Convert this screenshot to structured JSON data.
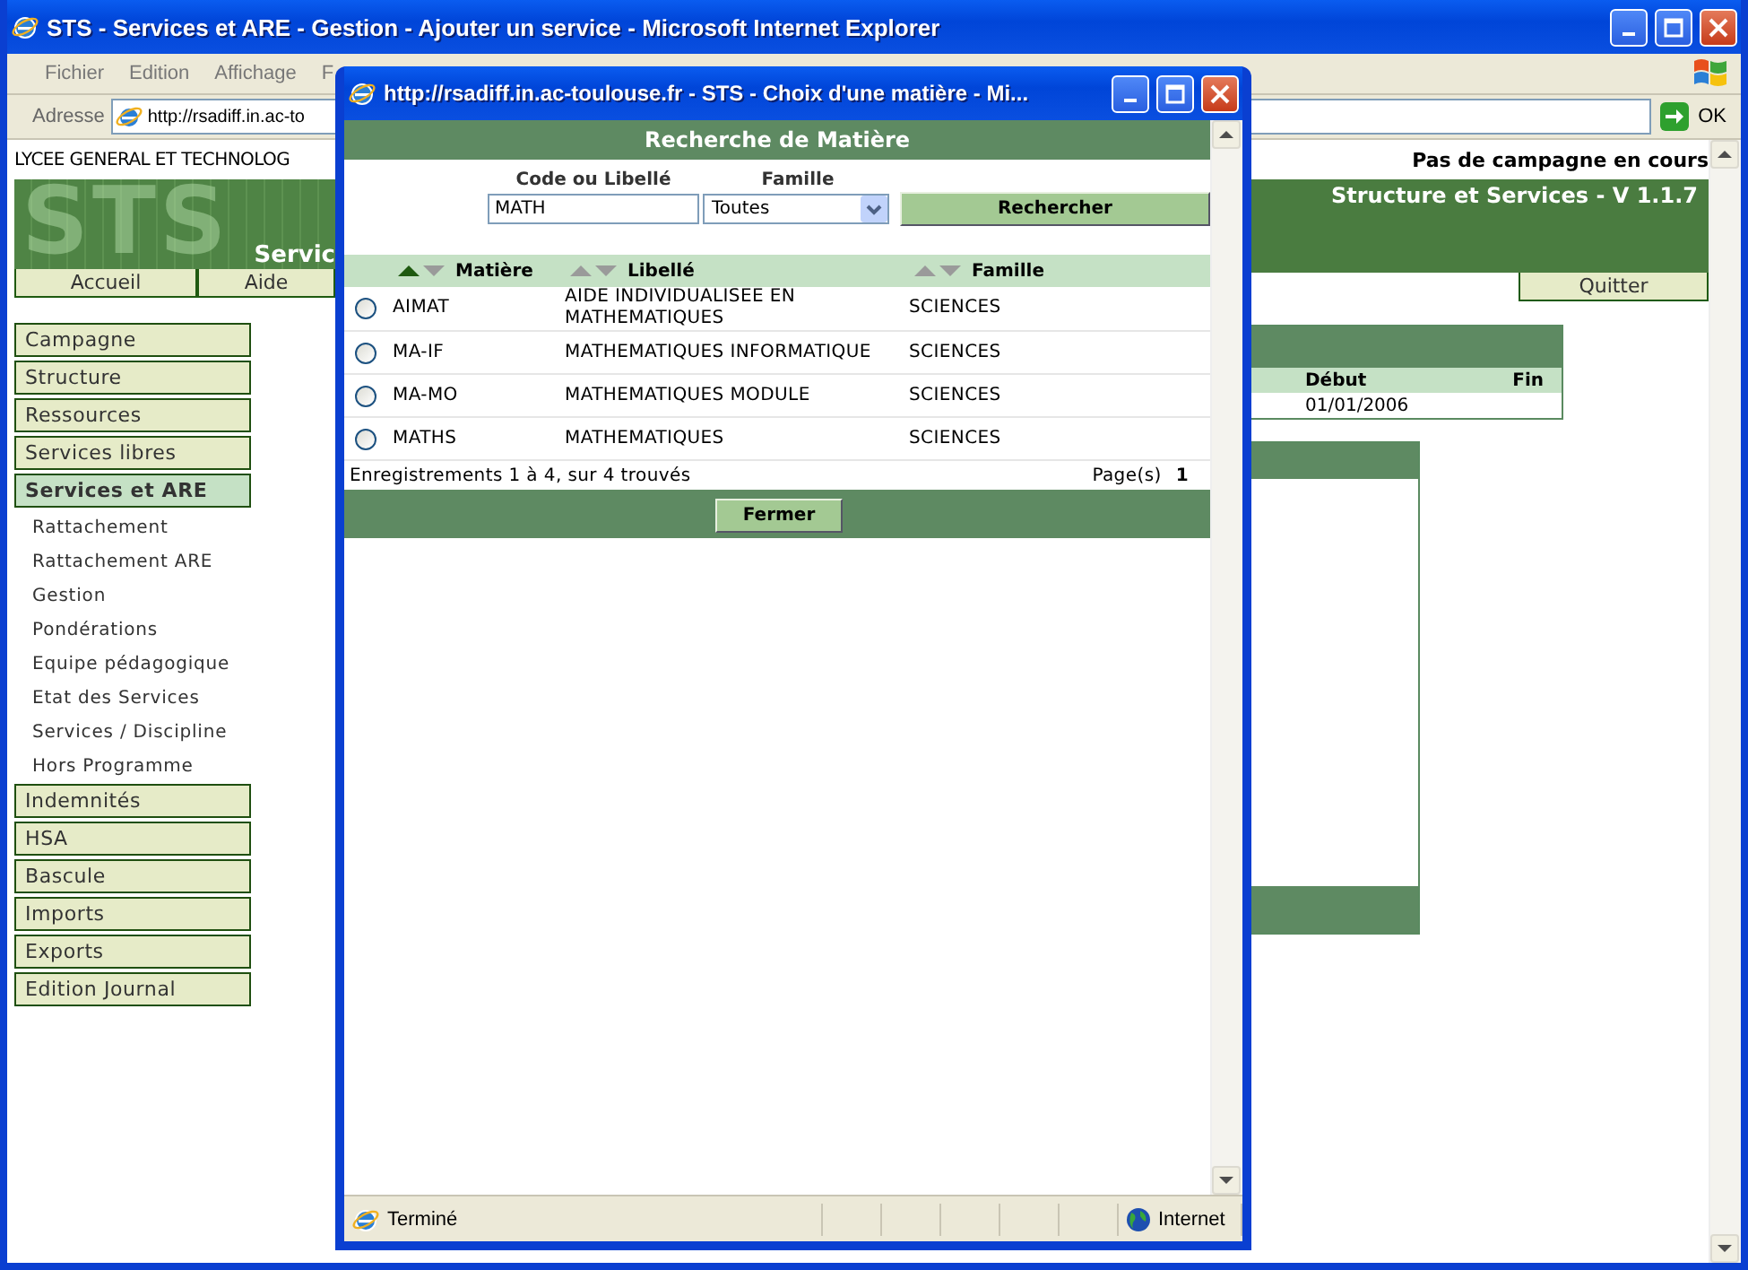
{
  "window": {
    "title": "STS - Services et ARE - Gestion - Ajouter un service - Microsoft Internet Explorer"
  },
  "menu": [
    "Fichier",
    "Edition",
    "Affichage",
    "F"
  ],
  "address_bar": {
    "label": "Adresse",
    "url": "http://rsadiff.in.ac-to",
    "go": "OK"
  },
  "page": {
    "school": "LYCEE GENERAL ET TECHNOLOG",
    "campaign": "Pas de campagne en cours",
    "logo": "STS",
    "section_title": "Servic",
    "app_title": "Structure et Services - V 1.1.7",
    "nav": [
      "Accueil",
      "Aide"
    ],
    "quit": "Quitter",
    "sidebar": [
      {
        "label": "Campagne",
        "selected": false
      },
      {
        "label": "Structure",
        "selected": false
      },
      {
        "label": "Ressources",
        "selected": false
      },
      {
        "label": "Services libres",
        "selected": false
      },
      {
        "label": "Services et ARE",
        "selected": true,
        "children": [
          "Rattachement",
          "Rattachement ARE",
          "Gestion",
          "Pondérations",
          "Equipe pédagogique",
          "Etat des Services",
          "Services / Discipline",
          "Hors Programme"
        ]
      },
      {
        "label": "Indemnités",
        "selected": false
      },
      {
        "label": "HSA",
        "selected": false
      },
      {
        "label": "Bascule",
        "selected": false
      },
      {
        "label": "Imports",
        "selected": false
      },
      {
        "label": "Exports",
        "selected": false
      },
      {
        "label": "Edition Journal",
        "selected": false
      }
    ],
    "period_table": {
      "columns": [
        "Début",
        "Fin"
      ],
      "rows": [
        {
          "start": "01/01/2006"
        }
      ]
    }
  },
  "popup": {
    "title": "http://rsadiff.in.ac-toulouse.fr - STS - Choix d'une matière - Mi...",
    "heading": "Recherche de Matière",
    "code_label": "Code ou Libellé",
    "code_value": "MATH",
    "family_label": "Famille",
    "family_value": "Toutes",
    "search_button": "Rechercher",
    "columns": [
      {
        "label": "Matière",
        "sorted": true
      },
      {
        "label": "Libellé",
        "sorted": false
      },
      {
        "label": "Famille",
        "sorted": false
      }
    ],
    "rows": [
      {
        "selected": false,
        "code": "AIMAT",
        "label": "AIDE INDIVIDUALISEE EN MATHEMATIQUES",
        "family": "SCIENCES"
      },
      {
        "selected": false,
        "code": "MA-IF",
        "label": "MATHEMATIQUES INFORMATIQUE",
        "family": "SCIENCES"
      },
      {
        "selected": false,
        "code": "MA-MO",
        "label": "MATHEMATIQUES MODULE",
        "family": "SCIENCES"
      },
      {
        "selected": false,
        "code": "MATHS",
        "label": "MATHEMATIQUES",
        "family": "SCIENCES"
      }
    ],
    "summary": "Enregistrements 1 à 4, sur 4 trouvés",
    "pages_label": "Page(s)",
    "page": "1",
    "close_button": "Fermer",
    "status": "Terminé",
    "zone": "Internet"
  }
}
